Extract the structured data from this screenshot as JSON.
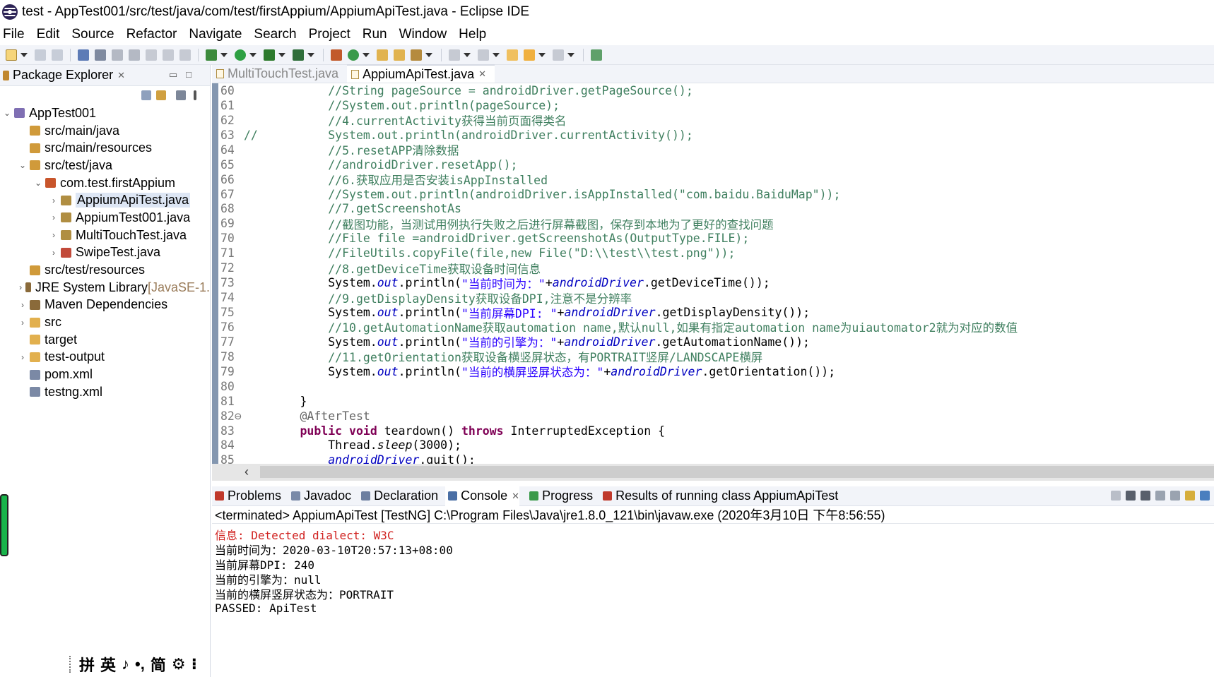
{
  "window": {
    "title": "test - AppTest001/src/test/java/com/test/firstAppium/AppiumApiTest.java - Eclipse IDE"
  },
  "menu": [
    "File",
    "Edit",
    "Source",
    "Refactor",
    "Navigate",
    "Search",
    "Project",
    "Run",
    "Window",
    "Help"
  ],
  "package_explorer": {
    "title": "Package Explorer",
    "close_symbol": "✕",
    "tree": [
      {
        "label": "AppTest001",
        "extra": "",
        "twisty": "⌄",
        "indent": 0,
        "icon": "project-icon",
        "selected": false
      },
      {
        "label": "src/main/java",
        "extra": "",
        "twisty": "",
        "indent": 1,
        "icon": "source-folder-icon",
        "selected": false
      },
      {
        "label": "src/main/resources",
        "extra": "",
        "twisty": "",
        "indent": 1,
        "icon": "source-folder-icon",
        "selected": false
      },
      {
        "label": "src/test/java",
        "extra": "",
        "twisty": "⌄",
        "indent": 1,
        "icon": "source-folder-icon",
        "selected": false
      },
      {
        "label": "com.test.firstAppium",
        "extra": "",
        "twisty": "⌄",
        "indent": 2,
        "icon": "package-icon",
        "selected": false
      },
      {
        "label": "AppiumApiTest.java",
        "extra": "",
        "twisty": "›",
        "indent": 3,
        "icon": "java-file-icon",
        "selected": true
      },
      {
        "label": "AppiumTest001.java",
        "extra": "",
        "twisty": "›",
        "indent": 3,
        "icon": "java-file-icon",
        "selected": false
      },
      {
        "label": "MultiTouchTest.java",
        "extra": "",
        "twisty": "›",
        "indent": 3,
        "icon": "java-file-icon",
        "selected": false
      },
      {
        "label": "SwipeTest.java",
        "extra": "",
        "twisty": "›",
        "indent": 3,
        "icon": "java-file-error-icon",
        "selected": false
      },
      {
        "label": "src/test/resources",
        "extra": "",
        "twisty": "",
        "indent": 1,
        "icon": "source-folder-icon",
        "selected": false
      },
      {
        "label": "JRE System Library ",
        "extra": "[JavaSE-1.",
        "twisty": "›",
        "indent": 1,
        "icon": "library-icon",
        "selected": false
      },
      {
        "label": "Maven Dependencies",
        "extra": "",
        "twisty": "›",
        "indent": 1,
        "icon": "library-icon",
        "selected": false
      },
      {
        "label": "src",
        "extra": "",
        "twisty": "›",
        "indent": 1,
        "icon": "folder-icon",
        "selected": false
      },
      {
        "label": "target",
        "extra": "",
        "twisty": "",
        "indent": 1,
        "icon": "folder-icon",
        "selected": false
      },
      {
        "label": "test-output",
        "extra": "",
        "twisty": "›",
        "indent": 1,
        "icon": "folder-icon",
        "selected": false
      },
      {
        "label": "pom.xml",
        "extra": "",
        "twisty": "",
        "indent": 1,
        "icon": "xml-file-icon",
        "selected": false
      },
      {
        "label": "testng.xml",
        "extra": "",
        "twisty": "",
        "indent": 1,
        "icon": "xml-file-icon",
        "selected": false
      }
    ]
  },
  "editor": {
    "tabs": [
      {
        "label": "MultiTouchTest.java",
        "active": false,
        "close": ""
      },
      {
        "label": "AppiumApiTest.java",
        "active": true,
        "close": "✕"
      }
    ],
    "lines": [
      {
        "num": "60",
        "parts": [
          [
            "plain",
            "            "
          ],
          [
            "cmt",
            "//String pageSource = androidDriver.getPageSource();"
          ]
        ]
      },
      {
        "num": "61",
        "parts": [
          [
            "plain",
            "            "
          ],
          [
            "cmt",
            "//System.out.println(pageSource);"
          ]
        ]
      },
      {
        "num": "62",
        "parts": [
          [
            "plain",
            "            "
          ],
          [
            "cmt",
            "//4.currentActivity获得当前页面得类名"
          ]
        ]
      },
      {
        "num": "63",
        "parts": [
          [
            "cmt",
            "//          System.out.println(androidDriver.currentActivity());"
          ]
        ]
      },
      {
        "num": "64",
        "parts": [
          [
            "plain",
            "            "
          ],
          [
            "cmt",
            "//5.resetAPP清除数据"
          ]
        ]
      },
      {
        "num": "65",
        "parts": [
          [
            "plain",
            "            "
          ],
          [
            "cmt",
            "//androidDriver.resetApp();"
          ]
        ]
      },
      {
        "num": "66",
        "parts": [
          [
            "plain",
            "            "
          ],
          [
            "cmt",
            "//6.获取应用是否安装isAppInstalled"
          ]
        ]
      },
      {
        "num": "67",
        "parts": [
          [
            "plain",
            "            "
          ],
          [
            "cmt",
            "//System.out.println(androidDriver.isAppInstalled(\"com.baidu.BaiduMap\"));"
          ]
        ]
      },
      {
        "num": "68",
        "parts": [
          [
            "plain",
            "            "
          ],
          [
            "cmt",
            "//7.getScreenshotAs"
          ]
        ]
      },
      {
        "num": "69",
        "parts": [
          [
            "plain",
            "            "
          ],
          [
            "cmt",
            "//截图功能，当测试用例执行失败之后进行屏幕截图，保存到本地为了更好的查找问题"
          ]
        ]
      },
      {
        "num": "70",
        "parts": [
          [
            "plain",
            "            "
          ],
          [
            "cmt",
            "//File file =androidDriver.getScreenshotAs(OutputType.FILE);"
          ]
        ]
      },
      {
        "num": "71",
        "parts": [
          [
            "plain",
            "            "
          ],
          [
            "cmt",
            "//FileUtils.copyFile(file,new File(\"D:\\\\test\\\\test.png\"));"
          ]
        ]
      },
      {
        "num": "72",
        "parts": [
          [
            "plain",
            "            "
          ],
          [
            "cmt",
            "//8.getDeviceTime获取设备时间信息"
          ]
        ]
      },
      {
        "num": "73",
        "parts": [
          [
            "plain",
            "            System."
          ],
          [
            "fld",
            "out"
          ],
          [
            "plain",
            ".println("
          ],
          [
            "str",
            "\"当前时间为：\""
          ],
          [
            "plain",
            "+"
          ],
          [
            "fld",
            "androidDriver"
          ],
          [
            "plain",
            ".getDeviceTime());"
          ]
        ]
      },
      {
        "num": "74",
        "parts": [
          [
            "plain",
            "            "
          ],
          [
            "cmt",
            "//9.getDisplayDensity获取设备DPI,注意不是分辨率"
          ]
        ]
      },
      {
        "num": "75",
        "parts": [
          [
            "plain",
            "            System."
          ],
          [
            "fld",
            "out"
          ],
          [
            "plain",
            ".println("
          ],
          [
            "str",
            "\"当前屏幕DPI: \""
          ],
          [
            "plain",
            "+"
          ],
          [
            "fld",
            "androidDriver"
          ],
          [
            "plain",
            ".getDisplayDensity());"
          ]
        ]
      },
      {
        "num": "76",
        "parts": [
          [
            "plain",
            "            "
          ],
          [
            "cmt",
            "//10.getAutomationName获取automation name,默认null,如果有指定automation name为uiautomator2就为对应的数值"
          ]
        ]
      },
      {
        "num": "77",
        "parts": [
          [
            "plain",
            "            System."
          ],
          [
            "fld",
            "out"
          ],
          [
            "plain",
            ".println("
          ],
          [
            "str",
            "\"当前的引擎为：\""
          ],
          [
            "plain",
            "+"
          ],
          [
            "fld",
            "androidDriver"
          ],
          [
            "plain",
            ".getAutomationName());"
          ]
        ]
      },
      {
        "num": "78",
        "parts": [
          [
            "plain",
            "            "
          ],
          [
            "cmt",
            "//11.getOrientation获取设备横竖屏状态，有PORTRAIT竖屏/LANDSCAPE横屏"
          ]
        ]
      },
      {
        "num": "79",
        "parts": [
          [
            "plain",
            "            System."
          ],
          [
            "fld",
            "out"
          ],
          [
            "plain",
            ".println("
          ],
          [
            "str",
            "\"当前的横屏竖屏状态为：\""
          ],
          [
            "plain",
            "+"
          ],
          [
            "fld",
            "androidDriver"
          ],
          [
            "plain",
            ".getOrientation());"
          ]
        ]
      },
      {
        "num": "80",
        "parts": [
          [
            "plain",
            ""
          ]
        ]
      },
      {
        "num": "81",
        "parts": [
          [
            "plain",
            "        }"
          ]
        ]
      },
      {
        "num": "82⊖",
        "parts": [
          [
            "plain",
            "        "
          ],
          [
            "ann",
            "@AfterTest"
          ]
        ]
      },
      {
        "num": "83",
        "parts": [
          [
            "plain",
            "        "
          ],
          [
            "kw",
            "public"
          ],
          [
            "plain",
            " "
          ],
          [
            "kw",
            "void"
          ],
          [
            "plain",
            " teardown() "
          ],
          [
            "kw",
            "throws"
          ],
          [
            "plain",
            " InterruptedException {"
          ]
        ]
      },
      {
        "num": "84",
        "parts": [
          [
            "plain",
            "            Thread."
          ],
          [
            "ital",
            "sleep"
          ],
          [
            "plain",
            "(3000);"
          ]
        ]
      },
      {
        "num": "85",
        "parts": [
          [
            "plain",
            "            "
          ],
          [
            "fld",
            "androidDriver"
          ],
          [
            "plain",
            ".quit();"
          ]
        ]
      }
    ]
  },
  "bottom_panel": {
    "tabs": [
      {
        "label": "Problems",
        "icon": "problems-icon",
        "active": false,
        "close": ""
      },
      {
        "label": "Javadoc",
        "icon": "javadoc-icon",
        "active": false,
        "close": ""
      },
      {
        "label": "Declaration",
        "icon": "declaration-icon",
        "active": false,
        "close": ""
      },
      {
        "label": "Console",
        "icon": "console-icon",
        "active": true,
        "close": "✕"
      },
      {
        "label": "Progress",
        "icon": "progress-icon",
        "active": false,
        "close": ""
      },
      {
        "label": "Results of running class AppiumApiTest",
        "icon": "testng-icon",
        "active": false,
        "close": ""
      }
    ],
    "console_header": "<terminated> AppiumApiTest [TestNG] C:\\Program Files\\Java\\jre1.8.0_121\\bin\\javaw.exe (2020年3月10日 下午8:56:55)",
    "console_lines": [
      {
        "text": "信息: Detected dialect: W3C",
        "color": "red"
      },
      {
        "text": "当前时间为：2020-03-10T20:57:13+08:00",
        "color": "black"
      },
      {
        "text": "当前屏幕DPI: 240",
        "color": "black"
      },
      {
        "text": "当前的引擎为：null",
        "color": "black"
      },
      {
        "text": "当前的横屏竖屏状态为：PORTRAIT",
        "color": "black"
      },
      {
        "text": "PASSED: ApiTest",
        "color": "black"
      }
    ]
  },
  "ime_bar": [
    "拼",
    "英",
    "♪",
    "•,",
    "简",
    "⚙",
    "⁝"
  ]
}
